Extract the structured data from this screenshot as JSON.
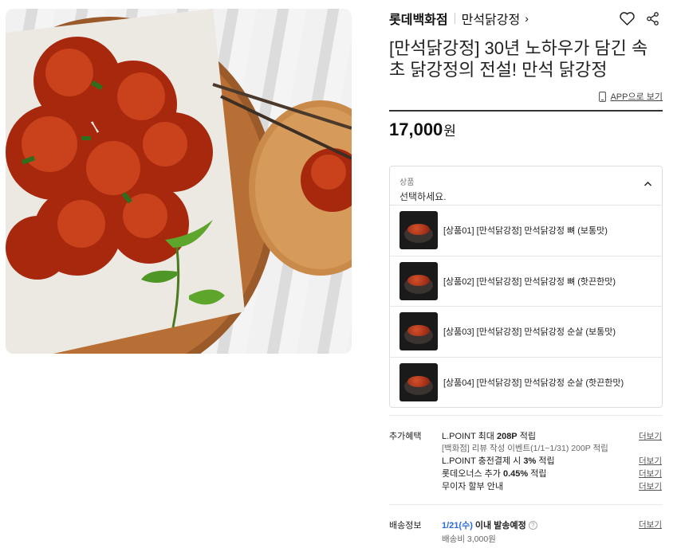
{
  "header": {
    "brand": "롯데백화점",
    "shop": "만석닭강정",
    "shop_chevron": "›"
  },
  "product": {
    "image_alt": "만석닭강정 닭강정 사진",
    "title": "[만석닭강정] 30년 노하우가 담긴 속초 닭강정의 전설! 만석 닭강정",
    "app_link": "APP으로 보기",
    "price": "17,000",
    "price_unit": "원"
  },
  "options": {
    "label": "상품",
    "placeholder": "선택하세요.",
    "items": [
      {
        "label": "[상품01] [만석닭강정] 만석닭강정 뼈 (보통맛)"
      },
      {
        "label": "[상품02] [만석닭강정] 만석닭강정 뼈 (핫끈한맛)"
      },
      {
        "label": "[상품03] [만석닭강정] 만석닭강정 순살 (보통맛)"
      },
      {
        "label": "[상품04] [만석닭강정] 만석닭강정 순살 (핫끈한맛)"
      }
    ]
  },
  "benefits": {
    "label": "추가혜택",
    "lpoint_prefix": "L.POINT 최대 ",
    "lpoint_amount": "208P",
    "lpoint_suffix": " 적립",
    "review_event": "[백화점] 리뷰 작성 이벤트(1/1~1/31) 200P 적립",
    "charge_prefix": "L.POINT 충전결제 시 ",
    "charge_rate": "3%",
    "charge_suffix": " 적립",
    "owners_prefix": "롯데오너스 추가 ",
    "owners_rate": "0.45%",
    "owners_suffix": " 적립",
    "installment": "무이자 할부 안내",
    "more": "더보기"
  },
  "shipping": {
    "label": "배송정보",
    "date": "1/21(수)",
    "date_suffix": " 이내 발송예정",
    "help": "?",
    "fee": "배송비 3,000원",
    "more": "더보기"
  },
  "colors": {
    "accent_blue": "#2c6cd6",
    "text": "#111111",
    "divider": "#333333"
  }
}
